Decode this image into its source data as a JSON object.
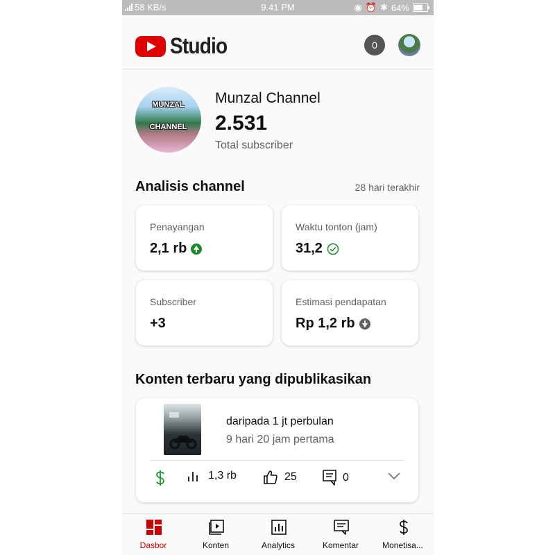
{
  "status_bar": {
    "network_speed": "58 KB/s",
    "time": "9.41 PM",
    "battery_percent": "64%",
    "battery_level": 0.64
  },
  "header": {
    "logo_text": "Studio",
    "notification_count": "0"
  },
  "channel": {
    "avatar_text_1": "MUNZAL",
    "avatar_text_2": "CHANNEL",
    "name": "Munzal Channel",
    "subscriber_count": "2.531",
    "subscriber_label": "Total subscriber"
  },
  "analytics": {
    "title": "Analisis channel",
    "period": "28 hari terakhir",
    "cards": [
      {
        "label": "Penayangan",
        "value": "2,1 rb",
        "trend": "up"
      },
      {
        "label": "Waktu tonton (jam)",
        "value": "31,2",
        "trend": "check"
      },
      {
        "label": "Subscriber",
        "value": "+3",
        "trend": "none"
      },
      {
        "label": "Estimasi pendapatan",
        "value": "Rp 1,2 rb",
        "trend": "down"
      }
    ]
  },
  "recent": {
    "title": "Konten terbaru yang dipublikasikan",
    "video": {
      "title": "daripada 1 jt perbulan",
      "subtitle": "9 hari 20 jam pertama",
      "views": "1,3 rb",
      "likes": "25",
      "comments": "0"
    }
  },
  "bottom_nav": [
    {
      "label": "Dasbor",
      "icon": "dashboard-icon",
      "active": true
    },
    {
      "label": "Konten",
      "icon": "content-icon",
      "active": false
    },
    {
      "label": "Analytics",
      "icon": "analytics-icon",
      "active": false
    },
    {
      "label": "Komentar",
      "icon": "comments-icon",
      "active": false
    },
    {
      "label": "Monetisa...",
      "icon": "monetization-icon",
      "active": false
    }
  ],
  "colors": {
    "brand_red": "#e00000",
    "active_nav": "#cc0000",
    "positive_green": "#1a8a2a",
    "muted_text": "#606060"
  }
}
